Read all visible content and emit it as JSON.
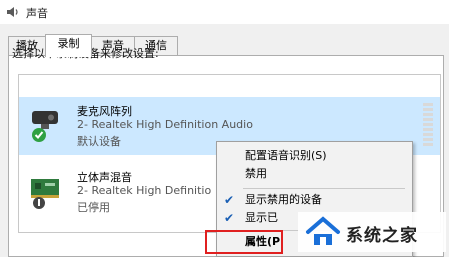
{
  "window": {
    "title": "声音"
  },
  "tabs": [
    {
      "label": "播放"
    },
    {
      "label": "录制"
    },
    {
      "label": "声音"
    },
    {
      "label": "通信"
    }
  ],
  "instruction": "选择以下录制设备来修改设置:",
  "devices": [
    {
      "name": "麦克风阵列",
      "driver": "2- Realtek High Definition Audio",
      "status": "默认设备",
      "state": "default",
      "selected": true
    },
    {
      "name": "立体声混音",
      "driver": "2- Realtek High Definitio",
      "status": "已停用",
      "state": "disabled",
      "selected": false
    }
  ],
  "context_menu": {
    "items": [
      {
        "label": "配置语音识别(S)",
        "checked": false
      },
      {
        "label": "禁用",
        "checked": false
      },
      {
        "label": "显示禁用的设备",
        "checked": true
      },
      {
        "label": "显示已",
        "checked": true
      },
      {
        "label": "属性(P",
        "checked": false
      }
    ]
  },
  "watermark": {
    "text": "系统之家"
  },
  "colors": {
    "selection": "#cce8ff",
    "highlight_box": "#e02020",
    "check": "#1a5fb4",
    "status_ok": "#2ea043"
  }
}
